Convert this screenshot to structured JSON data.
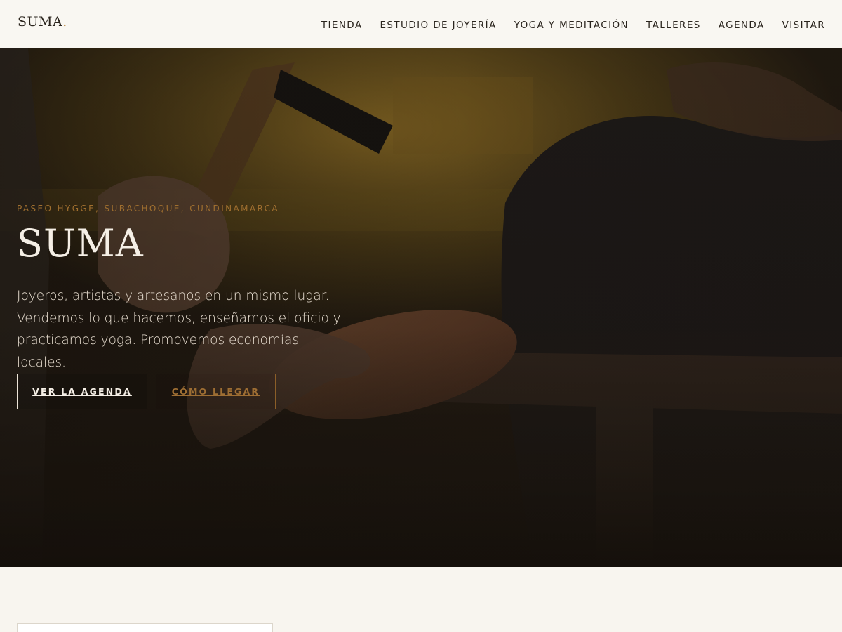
{
  "header": {
    "logo_text": "SUMA",
    "logo_dot": ".",
    "nav": [
      {
        "label": "TIENDA"
      },
      {
        "label": "ESTUDIO DE JOYERÍA"
      },
      {
        "label": "YOGA Y MEDITACIÓN"
      },
      {
        "label": "TALLERES"
      },
      {
        "label": "AGENDA"
      },
      {
        "label": "VISITAR"
      }
    ]
  },
  "hero": {
    "eyebrow": "PASEO HYGGE, SUBACHOQUE, CUNDINAMARCA",
    "title": "SUMA",
    "description": "Joyeros, artistas y artesanos en un mismo lugar. Vendemos lo que hacemos, enseñamos el oficio y practicamos yoga. Promovemos economías locales.",
    "primary_button": "VER LA AGENDA",
    "secondary_button": "CÓMO LLEGAR"
  },
  "colors": {
    "accent": "#a06f2f",
    "background": "#f8f5ef",
    "text_dark": "#2a241d"
  }
}
